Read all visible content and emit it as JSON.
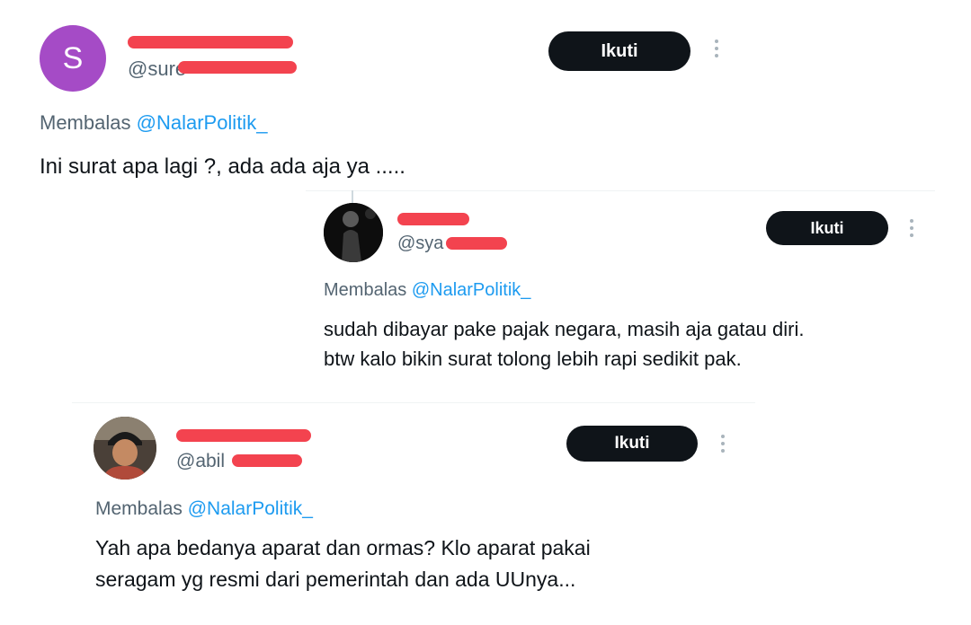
{
  "posts": [
    {
      "avatar_letter": "S",
      "avatar_color": "#a54bc6",
      "handle": "@sure",
      "follow_label": "Ikuti",
      "reply_prefix": "Membalas",
      "reply_mention": "@NalarPolitik_",
      "text": "Ini surat apa lagi ?, ada ada aja ya ....."
    },
    {
      "handle": "@sya",
      "follow_label": "Ikuti",
      "reply_prefix": "Membalas",
      "reply_mention": "@NalarPolitik_",
      "text_lines": [
        "sudah dibayar pake pajak negara, masih aja gatau diri.",
        "btw kalo bikin surat tolong lebih rapi sedikit pak."
      ]
    },
    {
      "handle": "@abil",
      "follow_label": "Ikuti",
      "reply_prefix": "Membalas",
      "reply_mention": "@NalarPolitik_",
      "text_lines": [
        "Yah apa bedanya aparat dan ormas? Klo aparat pakai",
        "seragam yg resmi dari pemerintah dan ada UUnya..."
      ]
    }
  ],
  "colors": {
    "redaction": "#f3434f",
    "button_bg": "#0f1419",
    "mention": "#1d9bf0",
    "muted": "#536471"
  }
}
